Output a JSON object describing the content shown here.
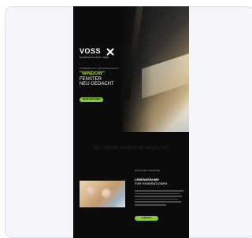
{
  "brochure": {
    "logo_text": "VOSS",
    "logo_tagline": "RAUMGESTALTUNG GMBH",
    "small_line": "FÜR MEHR LICHT UND WOHNQUALITÄT",
    "headline": [
      "\"WINDOW\"",
      "FENSTER",
      "NEU GEDACHT"
    ],
    "cta1": "MEHR ERFAHREN",
    "banner": "WO HEUTE SCHON MORGEN IST",
    "sub_label": "WIR PLANEN UND BAUEN",
    "sub_title": [
      "LEBENSRÄUME",
      "FÜR GENERATIONEN"
    ],
    "cta2": "KONTAKT"
  },
  "colors": {
    "accent": "#8cc63f",
    "background": "#0b0b0b"
  }
}
